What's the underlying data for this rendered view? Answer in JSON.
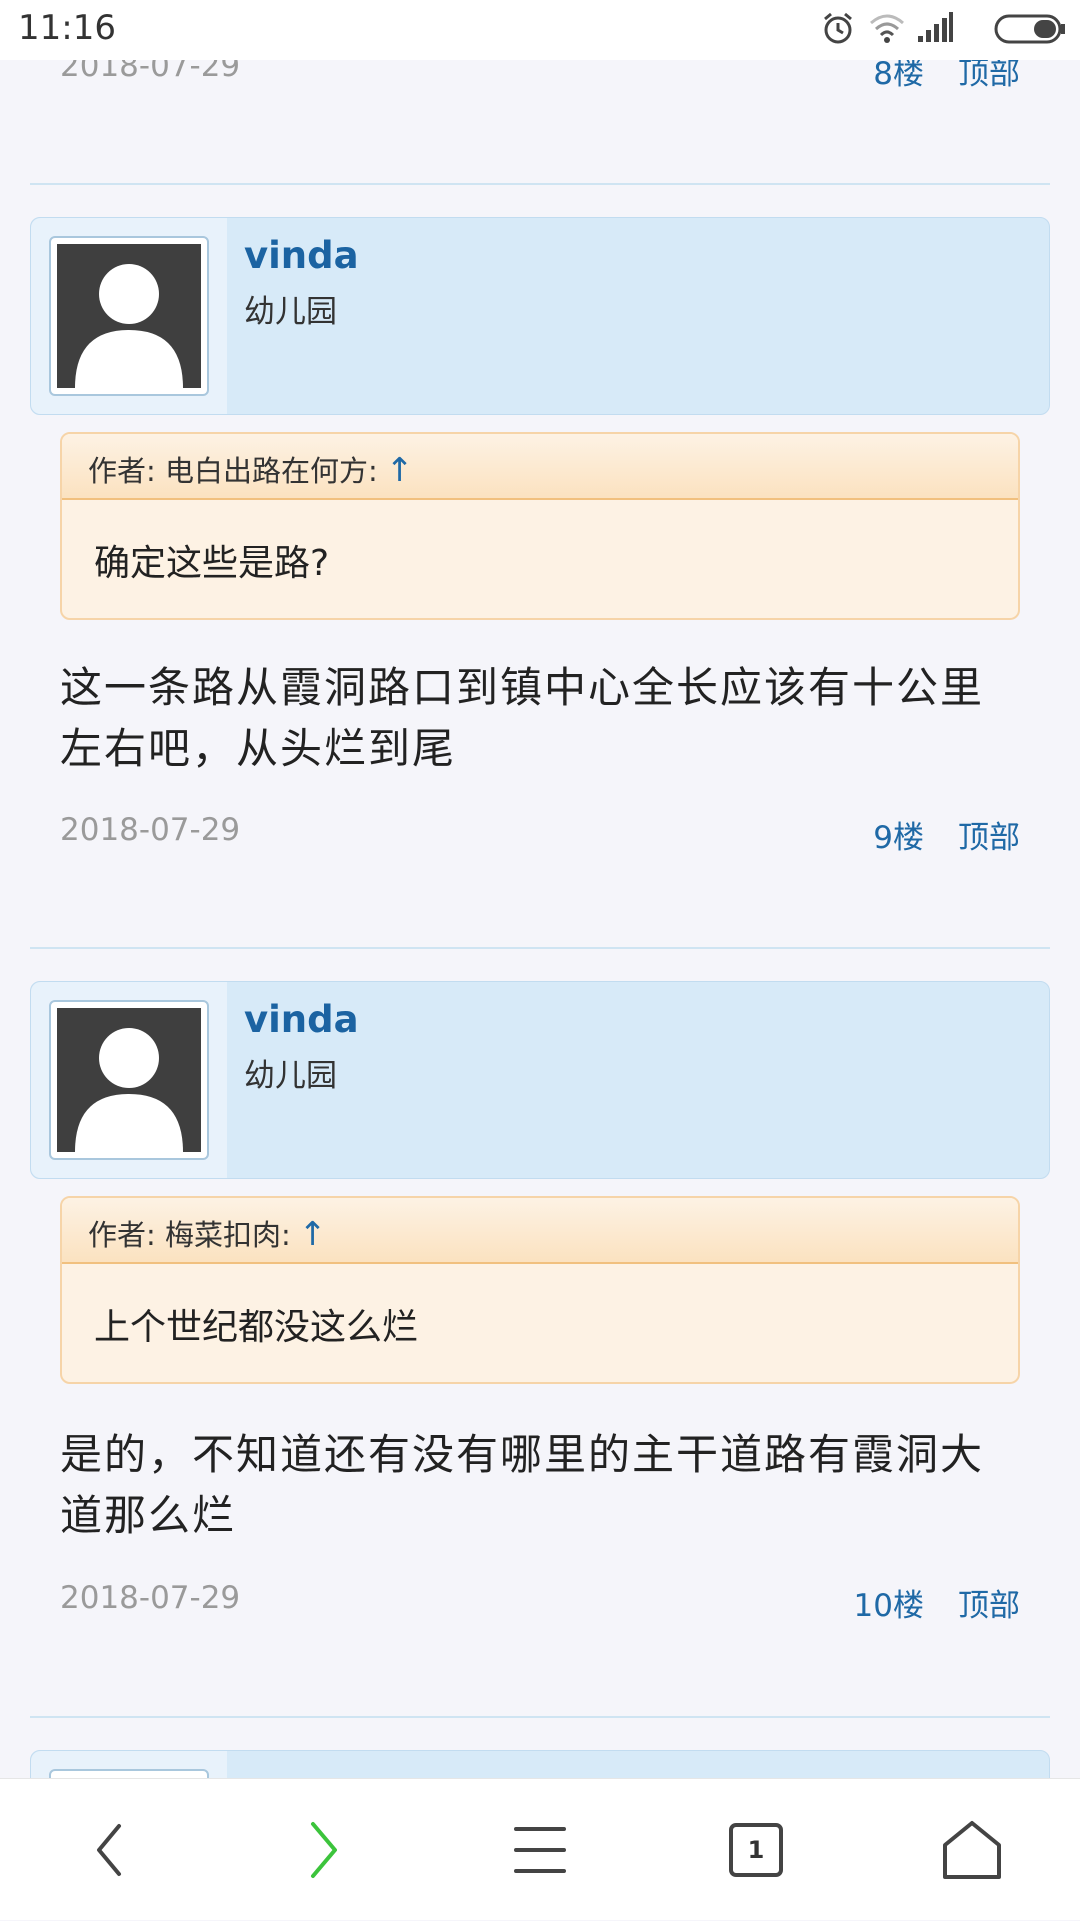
{
  "status_bar": {
    "time": "11:16",
    "icons": [
      "alarm-icon",
      "wifi-icon",
      "signal-icon",
      "battery-icon"
    ]
  },
  "prev_post_footer": {
    "date": "2018-07-29",
    "floor": "8楼",
    "top_link": "顶部"
  },
  "posts": [
    {
      "user": {
        "name": "vinda",
        "level": "幼儿园"
      },
      "quote": {
        "author_label": "作者: 电白出路在何方:",
        "arrow": "↑",
        "text": "确定这些是路?"
      },
      "text_lines": [
        "这一条路从霞洞路口到镇中心全长应该有十公里",
        "左右吧，从头烂到尾"
      ],
      "date": "2018-07-29",
      "floor": "9楼",
      "top_link": "顶部"
    },
    {
      "user": {
        "name": "vinda",
        "level": "幼儿园"
      },
      "quote": {
        "author_label": "作者: 梅菜扣肉:",
        "arrow": "↑",
        "text": "上个世纪都没这么烂"
      },
      "text_lines": [
        "是的，不知道还有没有哪里的主干道路有霞洞大",
        "道那么烂"
      ],
      "date": "2018-07-29",
      "floor": "10楼",
      "top_link": "顶部"
    }
  ],
  "bottom_nav": {
    "tab_count": "1",
    "icons": [
      "back-arrow-icon",
      "forward-arrow-icon",
      "menu-icon",
      "tabs-icon",
      "home-icon"
    ]
  },
  "colors": {
    "link_blue": "#1f69a6",
    "forward_green": "#3cc43c",
    "user_card_bg": "#d7eaf8",
    "quote_bg": "#fdf2e4"
  }
}
